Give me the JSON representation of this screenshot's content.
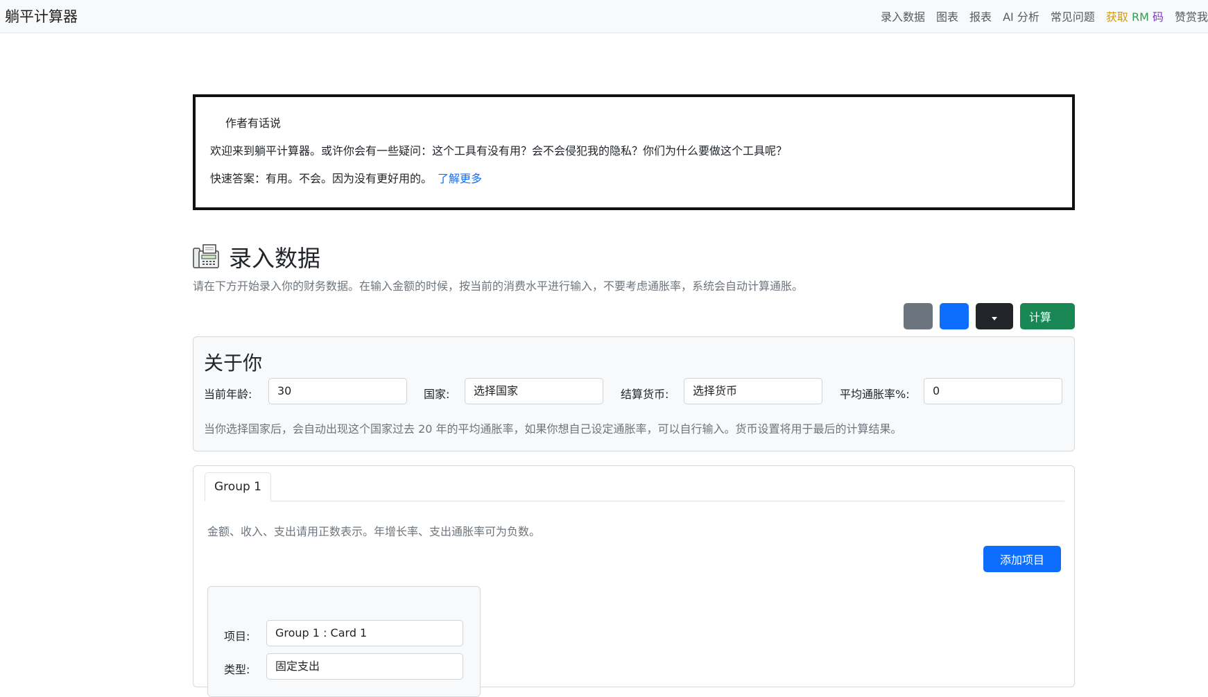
{
  "navbar": {
    "brand": "躺平计算器",
    "links": {
      "enter_data": "录入数据",
      "charts": "图表",
      "reports": "报表",
      "ai_analysis": "AI 分析",
      "faq": "常见问题",
      "get_rm_code": {
        "part1": "获取",
        "part2": "RM",
        "part3": "码"
      },
      "donate": "赞赏我"
    }
  },
  "notice": {
    "title": "作者有话说",
    "line1": "欢迎来到躺平计算器。或许你会有一些疑问：这个工具有没有用？会不会侵犯我的隐私？你们为什么要做这个工具呢？",
    "line2": "快速答案：有用。不会。因为没有更好用的。",
    "link": "了解更多"
  },
  "section": {
    "title": "录入数据",
    "description": "请在下方开始录入你的财务数据。在输入金额的时候，按当前的消费水平进行输入，不要考虑通胀率，系统会自动计算通胀。"
  },
  "toolbar": {
    "calculate": "计算"
  },
  "about": {
    "title": "关于你",
    "age_label": "当前年龄:",
    "age_value": "30",
    "country_label": "国家:",
    "country_value": "选择国家",
    "currency_label": "结算货币:",
    "currency_value": "选择货币",
    "inflation_label": "平均通胀率%:",
    "inflation_value": "0",
    "note": "当你选择国家后，会自动出现这个国家过去 20 年的平均通胀率，如果你想自己设定通胀率，可以自行输入。货币设置将用于最后的计算结果。"
  },
  "group": {
    "tab": "Group 1",
    "note": "金额、收入、支出请用正数表示。年增长率、支出通胀率可为负数。",
    "add_button": "添加项目",
    "card": {
      "item_label": "项目:",
      "item_value": "Group 1 : Card 1",
      "type_label": "类型:",
      "type_value": "固定支出"
    }
  }
}
